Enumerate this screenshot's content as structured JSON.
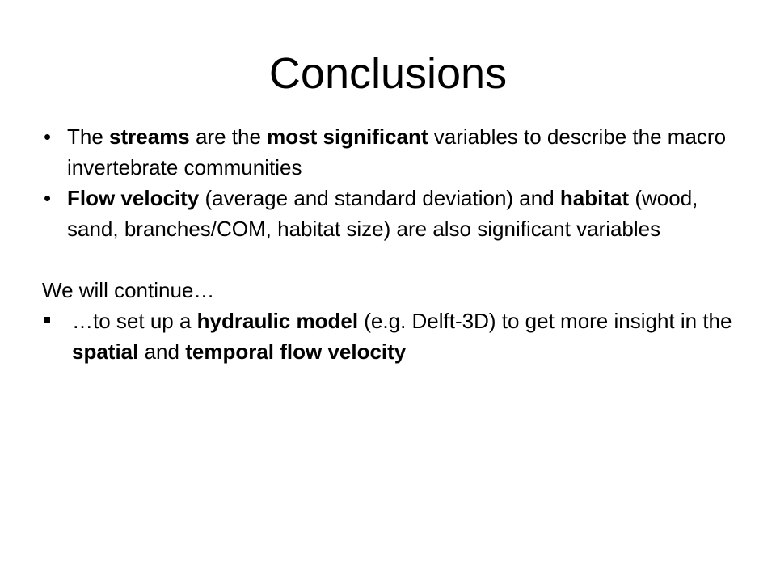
{
  "slide": {
    "title": "Conclusions",
    "bullets": [
      {
        "parts": [
          {
            "text": "The ",
            "bold": false
          },
          {
            "text": "streams",
            "bold": true
          },
          {
            "text": " are the ",
            "bold": false
          },
          {
            "text": "most significant",
            "bold": true
          },
          {
            "text": " variables to describe the macro invertebrate communities",
            "bold": false
          }
        ]
      },
      {
        "parts": [
          {
            "text": "Flow velocity",
            "bold": true
          },
          {
            "text": " (average and standard deviation) and ",
            "bold": false
          },
          {
            "text": "habitat",
            "bold": true
          },
          {
            "text": " (wood, sand, branches/COM, habitat size) are also significant variables",
            "bold": false
          }
        ]
      }
    ],
    "continue_heading": "We will continue…",
    "sub_bullets": [
      {
        "parts": [
          {
            "text": "…to set up a ",
            "bold": false
          },
          {
            "text": "hydraulic model",
            "bold": true
          },
          {
            "text": " (e.g. Delft-3D) to get more insight in the ",
            "bold": false
          },
          {
            "text": "spatial",
            "bold": true
          },
          {
            "text": " and ",
            "bold": false
          },
          {
            "text": "temporal flow velocity",
            "bold": true
          }
        ]
      }
    ],
    "bullet_glyph": "•"
  }
}
